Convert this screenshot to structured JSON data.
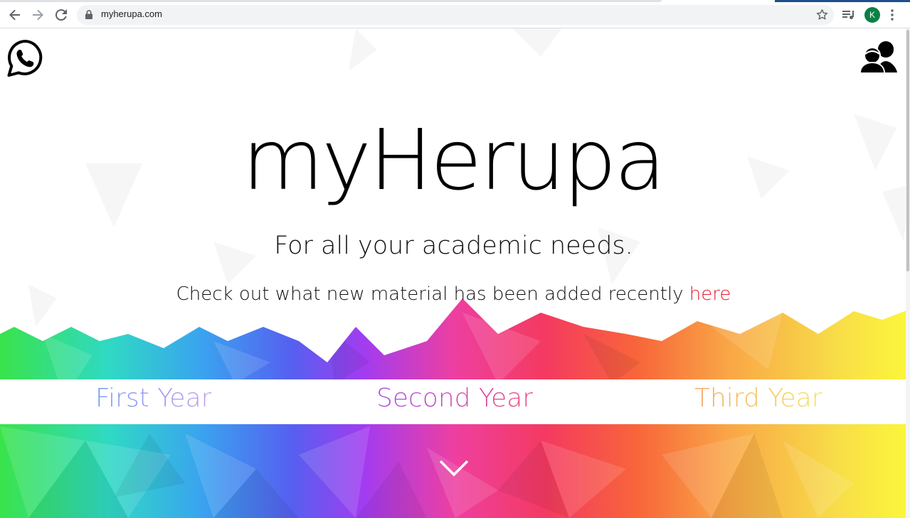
{
  "browser": {
    "url": "myherupa.com",
    "profile_initial": "K"
  },
  "page": {
    "title": "myHerupa",
    "tagline": "For all your academic needs.",
    "recent_text": "Check out what new material has been added recently ",
    "recent_link": "here",
    "years": [
      "First Year",
      "Second Year",
      "Third Year"
    ]
  },
  "icons": {
    "top_left": "whatsapp-icon",
    "top_right": "users-icon",
    "scroll_down": "chevron-down-icon"
  },
  "colors": {
    "link": "#e8192c",
    "profile": "#0b8043"
  }
}
